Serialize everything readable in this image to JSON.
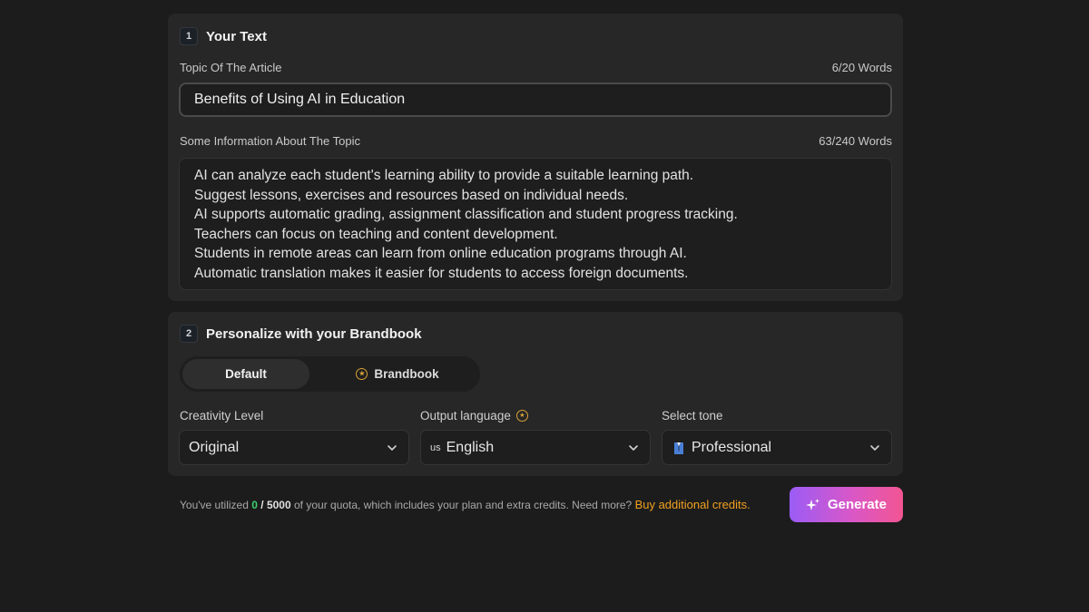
{
  "section1": {
    "number": "1",
    "title": "Your Text",
    "topic_label": "Topic Of The Article",
    "topic_count": "6/20 Words",
    "topic_value": "Benefits of Using AI in Education",
    "info_label": "Some Information About The Topic",
    "info_count": "63/240 Words",
    "info_lines": [
      "AI can analyze each student's learning ability to provide a suitable learning path.",
      "Suggest lessons, exercises and resources based on individual needs.",
      "AI supports automatic grading, assignment classification and student progress tracking.",
      "Teachers can focus on teaching and content development.",
      "Students in remote areas can learn from online education programs through AI.",
      "Automatic translation makes it easier for students to access foreign documents."
    ]
  },
  "section2": {
    "number": "2",
    "title": "Personalize with your Brandbook",
    "toggle": {
      "default_label": "Default",
      "brandbook_label": "Brandbook",
      "selected": "Default"
    },
    "creativity": {
      "label": "Creativity Level",
      "value": "Original"
    },
    "language": {
      "label": "Output language",
      "flag": "us",
      "value": "English"
    },
    "tone": {
      "label": "Select tone",
      "icon": "suit-icon",
      "value": "Professional"
    }
  },
  "footer": {
    "quota_prefix": "You've utilized",
    "used": "0",
    "total": "/ 5000",
    "quota_suffix": "of your quota, which includes your plan and extra credits. Need more?",
    "buy_link": "Buy additional credits.",
    "generate_label": "Generate"
  },
  "colors": {
    "accent_green": "#3ecf6e",
    "link_orange": "#f0a020",
    "premium_gold": "#d9a236",
    "button_gradient_start": "#9b5cf6",
    "button_gradient_end": "#f25592"
  }
}
